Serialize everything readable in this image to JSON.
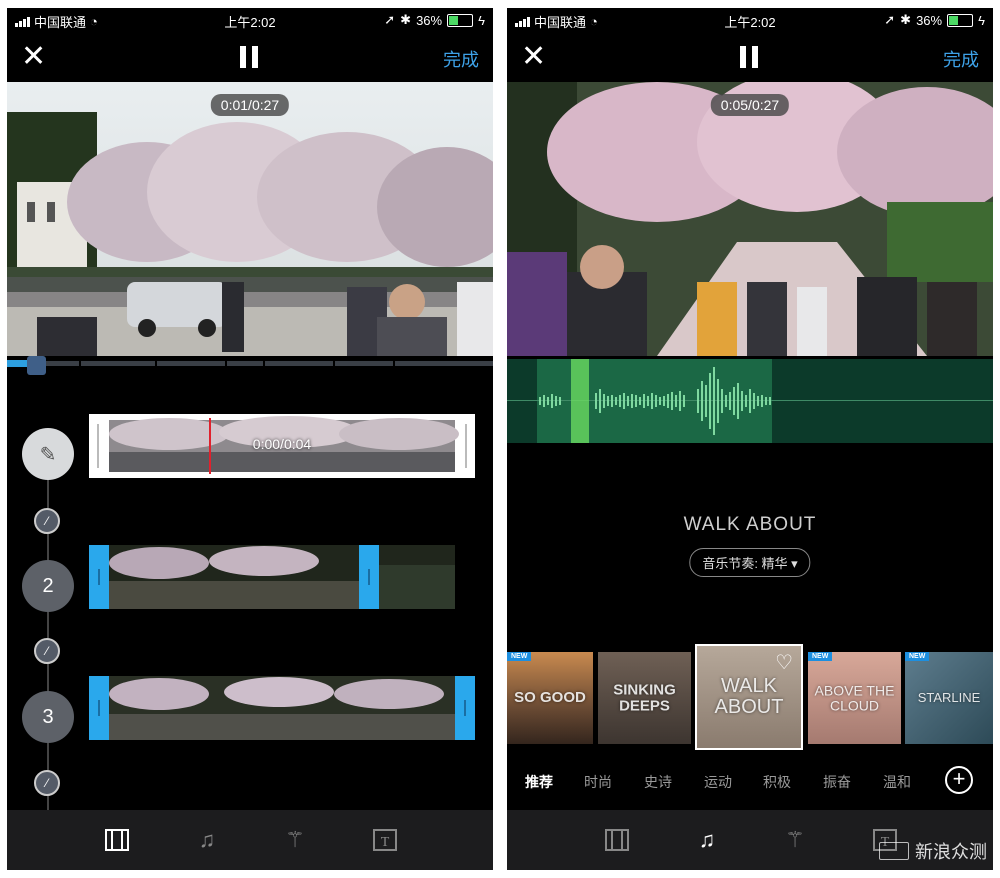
{
  "status_bar": {
    "carrier": "中国联通",
    "time": "上午2:02",
    "battery": "36%"
  },
  "nav": {
    "close_label": "✕",
    "done_label": "完成"
  },
  "editor": {
    "video_time": "0:01/0:27",
    "first_clip_time": "0:00/0:04",
    "clip_numbers": [
      "2",
      "3"
    ]
  },
  "music": {
    "video_time": "0:05/0:27",
    "song_title": "WALK ABOUT",
    "tempo_label": "音乐节奏: 精华 ▾",
    "cards": [
      {
        "title": "SO GOOD",
        "new": "NEW"
      },
      {
        "title": "SINKING DEEPS",
        "new": ""
      },
      {
        "title": "WALK ABOUT",
        "new": ""
      },
      {
        "title": "ABOVE THE CLOUD",
        "new": "NEW"
      },
      {
        "title": "STARLINE",
        "new": "NEW"
      }
    ],
    "categories": [
      "推荐",
      "时尚",
      "史诗",
      "运动",
      "积极",
      "振奋",
      "温和"
    ],
    "selected_category": "推荐"
  },
  "toolbar": {
    "icons": [
      "film-icon",
      "music-note-icon",
      "magic-wand-icon",
      "text-icon"
    ],
    "left_active": "film-icon",
    "right_active": "music-note-icon"
  },
  "watermark": {
    "text": "新浪众测"
  },
  "colors": {
    "accent_blue": "#3ea2e8",
    "clip_handle_blue": "#2aa8ec",
    "audio_green": "#1b6845",
    "playhead_green": "#6fe062"
  }
}
